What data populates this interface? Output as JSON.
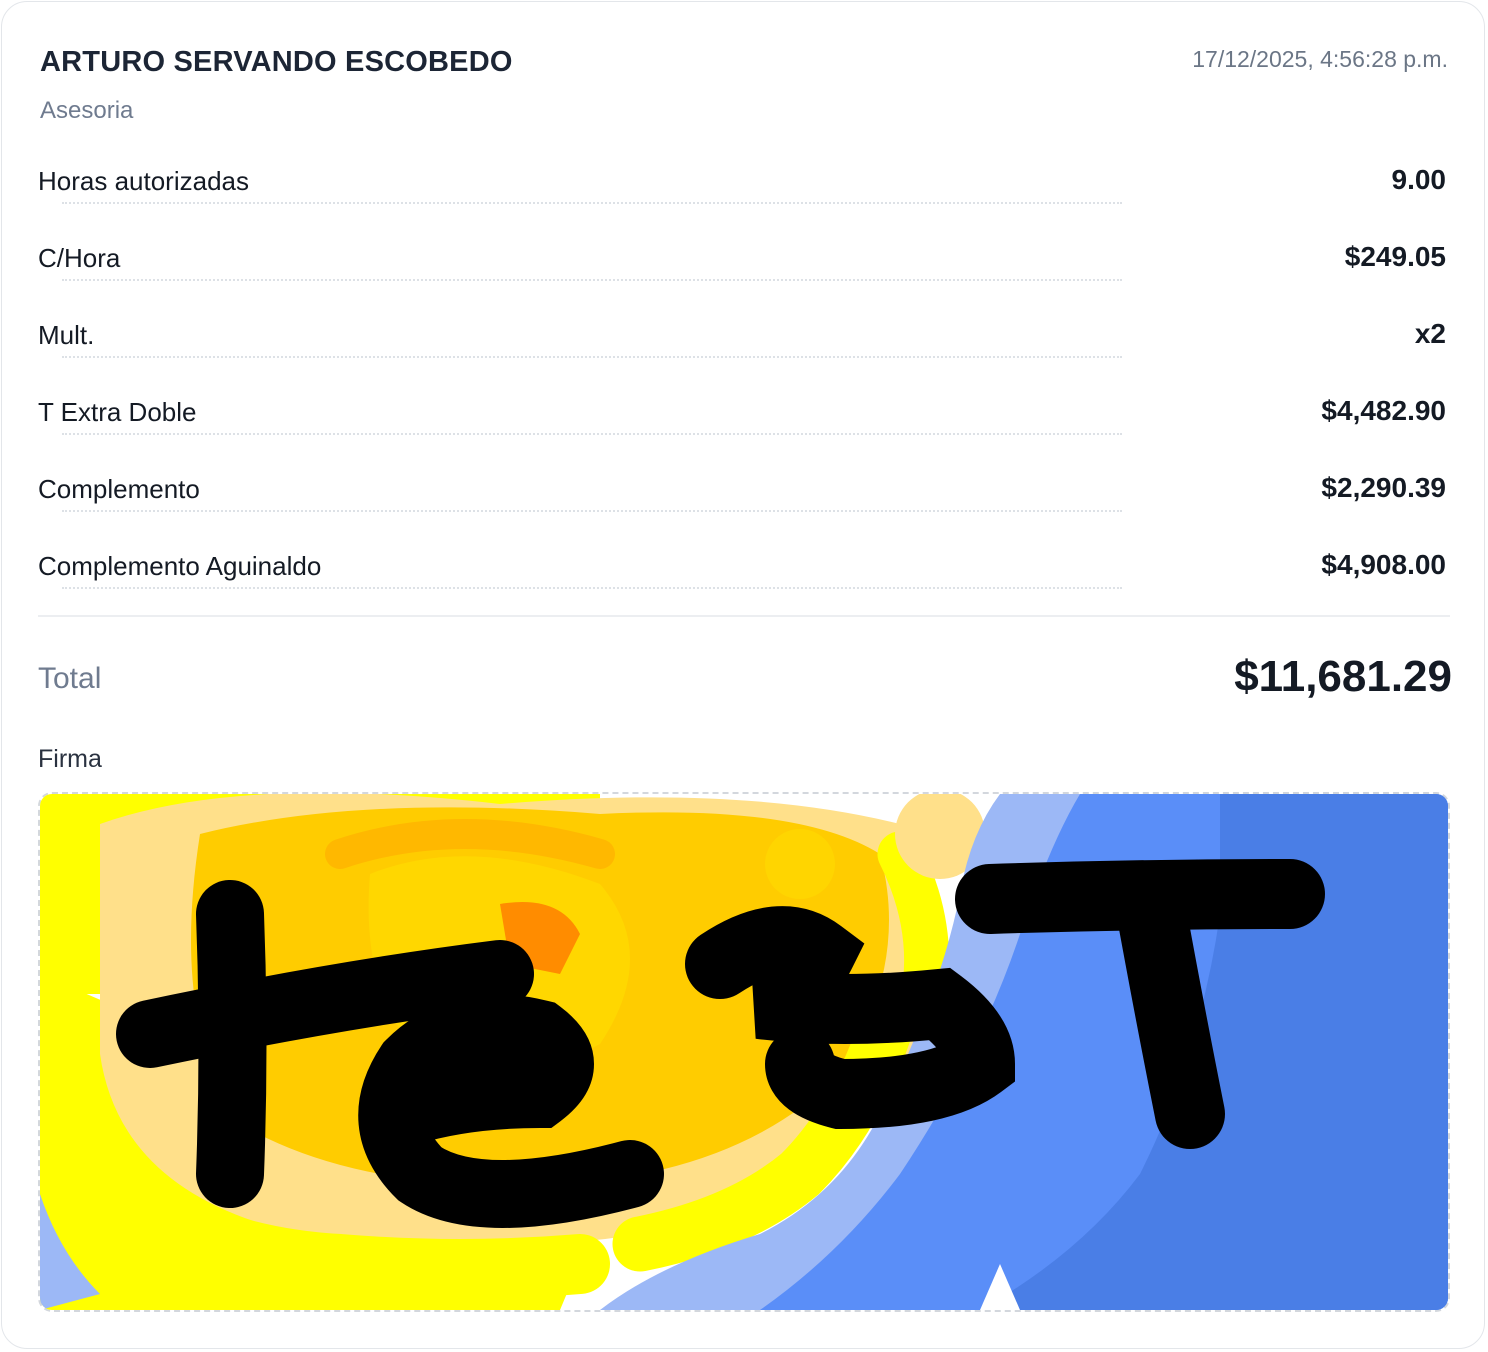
{
  "record": {
    "name": "ARTURO SERVANDO ESCOBEDO",
    "timestamp": "17/12/2025, 4:56:28 p.m.",
    "category": "Asesoria"
  },
  "rows": [
    {
      "label": "Horas autorizadas",
      "value": "9.00"
    },
    {
      "label": "C/Hora",
      "value": "$249.05"
    },
    {
      "label": "Mult.",
      "value": "x2"
    },
    {
      "label": "T Extra Doble",
      "value": "$4,482.90"
    },
    {
      "label": "Complemento",
      "value": "$2,290.39"
    },
    {
      "label": "Complemento Aguinaldo",
      "value": "$4,908.00"
    }
  ],
  "total": {
    "label": "Total",
    "value": "$11,681.29"
  },
  "signature": {
    "label": "Firma",
    "handwritten_text": "teST",
    "colors": {
      "yellow": "#ffff00",
      "amber": "#ffcc00",
      "light_yellow": "#ffe08a",
      "orange": "#ff8c00",
      "blue": "#5a8ef8",
      "dark_blue": "#4a7ee6",
      "light_blue": "#9cb8f6",
      "ink": "#000000"
    }
  }
}
